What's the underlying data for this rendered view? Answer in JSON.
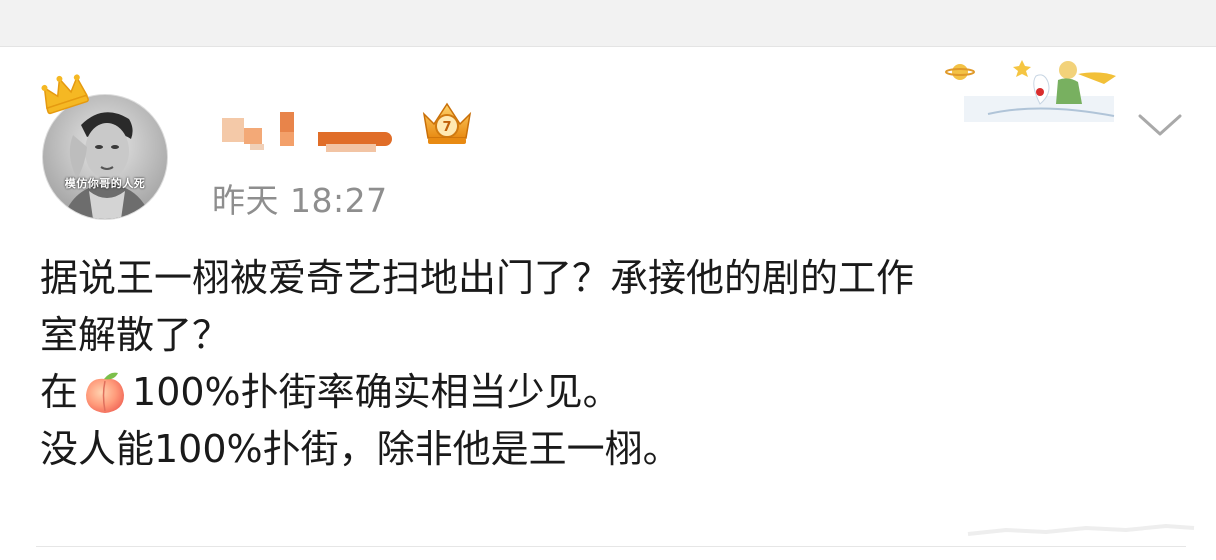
{
  "post": {
    "author_avatar_caption": "模仿你哥的人死",
    "timestamp": "昨天 18:27",
    "body_lines": {
      "l1": "据说王一栩被爱奇艺扫地出门了？承接他的剧的工作",
      "l2": "室解散了？",
      "l3_before": "在",
      "l3_after": "100%扑街率确实相当少见。",
      "l4": "没人能100%扑街，除非他是王一栩。"
    },
    "icons": {
      "crown": "crown-icon",
      "vip": "vip-crown-badge-icon",
      "peach": "peach-emoji-icon",
      "chevron": "chevron-down-icon",
      "decoration": "little-prince-card-decoration"
    }
  },
  "colors": {
    "text": "#1a1a1a",
    "timestamp": "#8e8e8e",
    "top_band": "#f2f2f2",
    "crown": "#f5b823",
    "vip_badge": "#f0a020"
  }
}
